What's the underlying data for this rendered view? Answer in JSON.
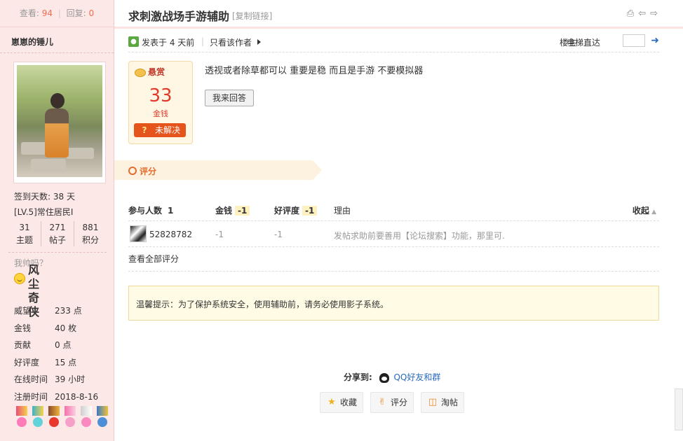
{
  "sidebar": {
    "views_label": "查看:",
    "views": "94",
    "replies_label": "回复:",
    "replies": "0",
    "username": "崽崽的锤儿",
    "signin": "签到天数: 38 天",
    "level": "[LV.5]常住居民I",
    "counts": [
      {
        "value": "31",
        "label": "主题"
      },
      {
        "value": "271",
        "label": "帖子"
      },
      {
        "value": "881",
        "label": "积分"
      }
    ],
    "group_title": "风尘奇侠",
    "motto": "我帅吗？",
    "props": [
      {
        "key": "威望",
        "value": "233 点"
      },
      {
        "key": "金钱",
        "value": "40 枚"
      },
      {
        "key": "贡献",
        "value": "0 点"
      },
      {
        "key": "好评度",
        "value": "15 点"
      },
      {
        "key": "在线时间",
        "value": "39 小时"
      },
      {
        "key": "注册时间",
        "value": "2018-8-16"
      }
    ]
  },
  "thread": {
    "title": "求刺激战场手游辅助",
    "copy_link": "[复制链接]",
    "posted": "发表于 4 天前",
    "only_author": "只看该作者",
    "floor": "楼主",
    "elevator": "电梯直达",
    "question": "透视或者除草都可以 重要是稳 而且是手游 不要模拟器",
    "answer_button": "我来回答"
  },
  "bounty": {
    "label": "悬赏",
    "amount": "33",
    "unit": "金钱",
    "status": "未解决"
  },
  "rating": {
    "banner": "评分",
    "headers": {
      "participants": "参与人数",
      "participants_count": "1",
      "money": "金钱",
      "money_total": "-1",
      "reputation": "好评度",
      "reputation_total": "-1",
      "reason": "理由",
      "collapse": "收起"
    },
    "rows": [
      {
        "user": "52828782",
        "money": "-1",
        "reputation": "-1",
        "reason": "发帖求助前要善用【论坛搜索】功能，那里可."
      }
    ],
    "see_all": "查看全部评分"
  },
  "notice": "温馨提示：为了保护系统安全，使用辅助前，请务必使用影子系统。",
  "share": {
    "label": "分享到:",
    "target": "QQ好友和群"
  },
  "actions": [
    {
      "label": "收藏",
      "icon": "star-icon"
    },
    {
      "label": "评分",
      "icon": "thumb-icon"
    },
    {
      "label": "淘帖",
      "icon": "tray-icon"
    }
  ],
  "colors": {
    "sidebar_bg": "#fde8e8",
    "accent_orange": "#e76b2a",
    "bounty_red": "#e03a2b",
    "link_blue": "#2a6bbf"
  }
}
